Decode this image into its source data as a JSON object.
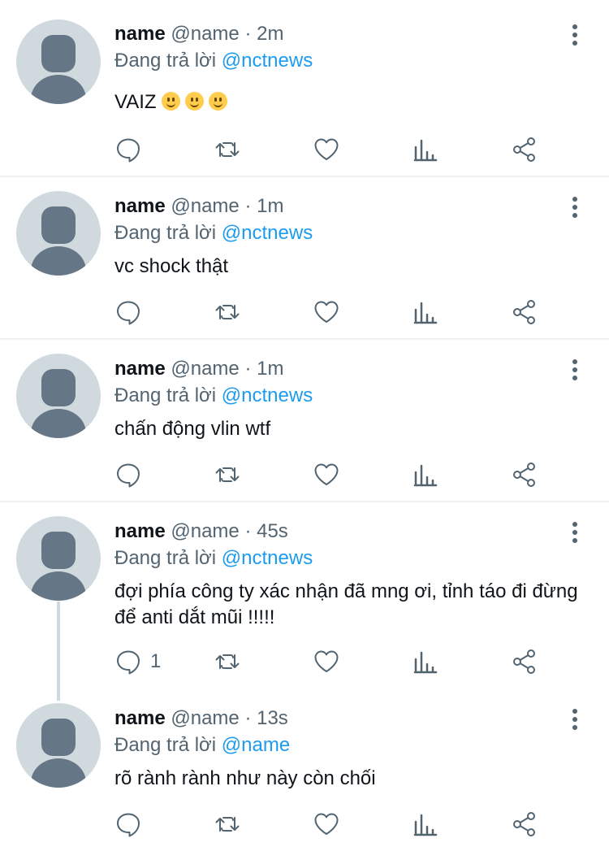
{
  "colors": {
    "accent": "#1d9bf0",
    "secondary_text": "#536471",
    "avatar_bg": "#cfd9de"
  },
  "icons": {
    "reply": "comment-bubble-icon",
    "retweet": "retweet-icon",
    "like": "heart-icon",
    "views": "bar-chart-icon",
    "share": "share-icon",
    "more": "more-vertical-icon"
  },
  "tweets": [
    {
      "name": "name",
      "meta": "@name · 2m",
      "reply_prefix": "Đang trả lời",
      "reply_to": "@nctnews",
      "text": "VAIZ",
      "emoji": "slightly-smiling-face",
      "emoji_count": 3,
      "reply_count": ""
    },
    {
      "name": "name",
      "meta": "@name · 1m",
      "reply_prefix": "Đang trả lời",
      "reply_to": "@nctnews",
      "text": "vc shock thật",
      "reply_count": ""
    },
    {
      "name": "name",
      "meta": "@name · 1m",
      "reply_prefix": "Đang trả lời",
      "reply_to": "@nctnews",
      "text": "chấn động vlin wtf",
      "reply_count": ""
    },
    {
      "name": "name",
      "meta": "@name · 45s",
      "reply_prefix": "Đang trả lời",
      "reply_to": "@nctnews",
      "text": "đợi phía công ty xác nhận đã mng ơi, tỉnh táo đi đừng để anti dắt mũi !!!!!",
      "reply_count": "1"
    },
    {
      "name": "name",
      "meta": "@name · 13s",
      "reply_prefix": "Đang trả lời",
      "reply_to": "@name",
      "text": "rõ rành rành như này còn chối",
      "reply_count": ""
    }
  ]
}
